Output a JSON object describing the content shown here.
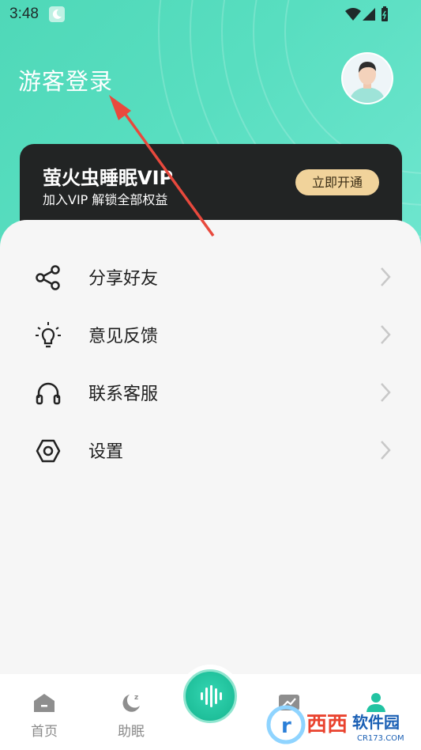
{
  "status_bar": {
    "time": "3:48"
  },
  "header": {
    "login_label": "游客登录"
  },
  "vip": {
    "title": "萤火虫睡眠VIP",
    "subtitle": "加入VIP 解锁全部权益",
    "button_label": "立即开通",
    "button_color": "#f1d39b",
    "card_color": "#222424"
  },
  "menu": {
    "items": [
      {
        "label": "分享好友",
        "icon": "share-icon"
      },
      {
        "label": "意见反馈",
        "icon": "lightbulb-icon"
      },
      {
        "label": "联系客服",
        "icon": "headphones-icon"
      },
      {
        "label": "设置",
        "icon": "settings-hexagon-icon"
      }
    ]
  },
  "tabs": [
    {
      "label": "首页",
      "icon": "home-icon",
      "active": false
    },
    {
      "label": "助眠",
      "icon": "moon-sleep-icon",
      "active": false
    },
    {
      "label": "",
      "icon": "sound-wave-icon",
      "active": false
    },
    {
      "label": "",
      "icon": "chart-trend-icon",
      "active": false
    },
    {
      "label": "",
      "icon": "profile-icon",
      "active": true
    }
  ],
  "colors": {
    "accent": "#3cd2b0",
    "active_tab": "#22c3a2"
  },
  "watermark": {
    "text": "西西软件园",
    "url_text": "CR173.COM"
  }
}
